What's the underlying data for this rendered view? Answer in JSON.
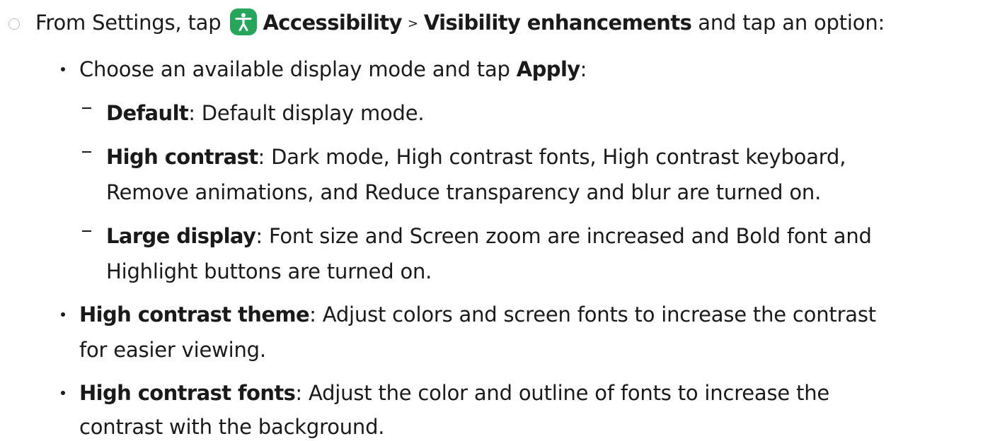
{
  "intro": {
    "prefix": "From Settings, tap",
    "icon": "accessibility-icon",
    "icon_color": "#27a65b",
    "accessibility": "Accessibility",
    "separator": ">",
    "visibility": "Visibility enhancements",
    "suffix": "and tap an option:"
  },
  "bullets": [
    {
      "text": "Choose an available display mode and tap",
      "bold_end": "Apply",
      "colon": ":",
      "modes": [
        {
          "term": "Default",
          "colon": ":",
          "desc": "Default display mode."
        },
        {
          "term": "High contrast",
          "colon": ":",
          "desc_line1": "Dark mode, High contrast fonts, High contrast keyboard,",
          "desc_line2": "Remove animations, and Reduce transparency and blur are turned on."
        },
        {
          "term": "Large display",
          "colon": ":",
          "desc_line1": "Font size and Screen zoom are increased and Bold font and",
          "desc_line2": "Highlight buttons are turned on."
        }
      ]
    },
    {
      "term": "High contrast theme",
      "colon": ":",
      "desc_line1": "Adjust colors and screen fonts to increase the contrast",
      "desc_line2": "for easier viewing."
    },
    {
      "term": "High contrast fonts",
      "colon": ":",
      "desc_line1": "Adjust the color and outline of fonts to increase the",
      "desc_line2": "contrast with the background."
    }
  ]
}
